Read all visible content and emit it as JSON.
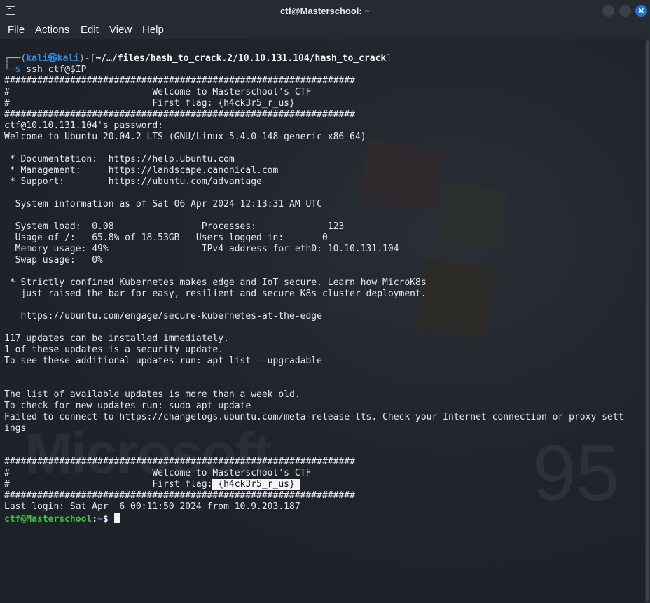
{
  "window": {
    "title": "ctf@Masterschool: ~",
    "icon": "terminal-icon",
    "controls": {
      "minimize": "minimize-icon",
      "maximize": "maximize-icon",
      "close": "×"
    }
  },
  "menu": [
    "File",
    "Actions",
    "Edit",
    "View",
    "Help"
  ],
  "prompt1": {
    "corner_top": "┌──(",
    "user": "kali",
    "at_symbol": "㉿",
    "host": "kali",
    "mid": ")-[",
    "path": "~/…/files/hash_to_crack.2/10.10.131.104/hash_to_crack",
    "close": "]",
    "corner_bottom": "└─",
    "dollar": "$",
    "command": " ssh ctf@$IP"
  },
  "lines": {
    "l01": "################################################################",
    "l02": "#                          Welcome to Masterschool's CTF",
    "l03": "#                          First flag: {h4ck3r5_r_us}",
    "l04": "################################################################",
    "l05": "ctf@10.10.131.104's password:",
    "l06": "Welcome to Ubuntu 20.04.2 LTS (GNU/Linux 5.4.0-148-generic x86_64)",
    "l07": "",
    "l08": " * Documentation:  https://help.ubuntu.com",
    "l09": " * Management:     https://landscape.canonical.com",
    "l10": " * Support:        https://ubuntu.com/advantage",
    "l11": "",
    "l12": "  System information as of Sat 06 Apr 2024 12:13:31 AM UTC",
    "l13": "",
    "l14": "  System load:  0.08                Processes:             123",
    "l15": "  Usage of /:   65.8% of 18.53GB   Users logged in:       0",
    "l16": "  Memory usage: 49%                 IPv4 address for eth0: 10.10.131.104",
    "l17": "  Swap usage:   0%",
    "l18": "",
    "l19": " * Strictly confined Kubernetes makes edge and IoT secure. Learn how MicroK8s",
    "l20": "   just raised the bar for easy, resilient and secure K8s cluster deployment.",
    "l21": "",
    "l22": "   https://ubuntu.com/engage/secure-kubernetes-at-the-edge",
    "l23": "",
    "l24": "117 updates can be installed immediately.",
    "l25": "1 of these updates is a security update.",
    "l26": "To see these additional updates run: apt list --upgradable",
    "l27": "",
    "l28": "",
    "l29": "The list of available updates is more than a week old.",
    "l30": "To check for new updates run: sudo apt update",
    "l31": "Failed to connect to https://changelogs.ubuntu.com/meta-release-lts. Check your Internet connection or proxy sett",
    "l32": "ings",
    "l33": "",
    "l34": "",
    "l35": "################################################################",
    "l36": "#                          Welcome to Masterschool's CTF",
    "l37a": "#                          First flag:",
    "l37b": " {h4ck3r5_r_us} ",
    "l38": "################################################################",
    "l39": "Last login: Sat Apr  6 00:11:50 2024 from 10.9.203.187"
  },
  "prompt2": {
    "user_host": "ctf@Masterschool",
    "colon": ":",
    "path": "~",
    "dollar": "$ "
  },
  "wallpaper": {
    "text": "Microsoft",
    "number": "95"
  },
  "colors": {
    "prompt_blue": "#2e8de3",
    "prompt_green": "#40c040",
    "highlight_bg": "#f5f5f5",
    "close_button": "#1d74d6"
  }
}
